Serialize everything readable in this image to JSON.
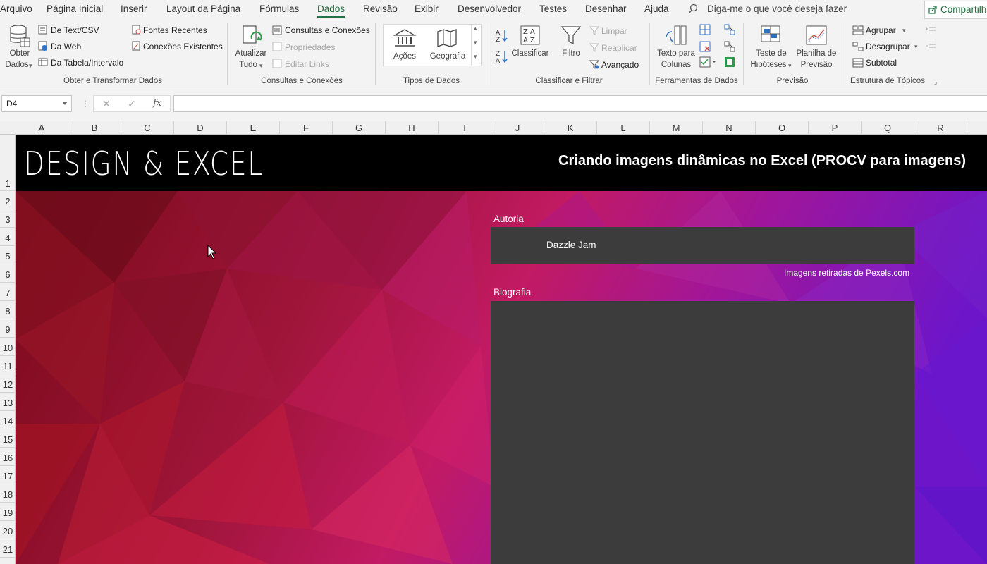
{
  "menu": {
    "tabs": [
      "Arquivo",
      "Página Inicial",
      "Inserir",
      "Layout da Página",
      "Fórmulas",
      "Dados",
      "Revisão",
      "Exibir",
      "Desenvolvedor",
      "Testes",
      "Desenhar",
      "Ajuda"
    ],
    "active_tab": "Dados",
    "tell_me": "Diga-me o que você deseja fazer",
    "share": "Compartilhar"
  },
  "ribbon": {
    "get_transform": {
      "obter_line1": "Obter",
      "obter_line2": "Dados",
      "text_csv": "De Text/CSV",
      "web": "Da Web",
      "table_range": "Da Tabela/Intervalo",
      "recent_sources": "Fontes Recentes",
      "existing_connections": "Conexões Existentes",
      "group_label": "Obter e Transformar Dados"
    },
    "queries": {
      "refresh_line1": "Atualizar",
      "refresh_line2": "Tudo",
      "queries_connections": "Consultas e Conexões",
      "properties": "Propriedades",
      "edit_links": "Editar Links",
      "group_label": "Consultas e Conexões"
    },
    "data_types": {
      "stocks": "Ações",
      "geography": "Geografia",
      "group_label": "Tipos de Dados"
    },
    "sort_filter": {
      "sort": "Classificar",
      "filter": "Filtro",
      "clear": "Limpar",
      "reapply": "Reaplicar",
      "advanced": "Avançado",
      "group_label": "Classificar e Filtrar"
    },
    "data_tools": {
      "text_columns_line1": "Texto para",
      "text_columns_line2": "Colunas",
      "group_label": "Ferramentas de Dados"
    },
    "forecast": {
      "what_if_line1": "Teste de",
      "what_if_line2": "Hipóteses",
      "forecast_sheet_line1": "Planilha de",
      "forecast_sheet_line2": "Previsão",
      "group_label": "Previsão"
    },
    "outline": {
      "group": "Agrupar",
      "ungroup": "Desagrupar",
      "subtotal": "Subtotal",
      "group_label": "Estrutura de Tópicos"
    }
  },
  "formula_bar": {
    "name_box": "D4",
    "fx": "fx",
    "content": ""
  },
  "grid": {
    "columns": [
      "A",
      "B",
      "C",
      "D",
      "E",
      "F",
      "G",
      "H",
      "I",
      "J",
      "K",
      "L",
      "M",
      "N",
      "O",
      "P",
      "Q",
      "R"
    ],
    "rows": [
      "1",
      "2",
      "3",
      "4",
      "5",
      "6",
      "7",
      "8",
      "9",
      "10",
      "11",
      "12",
      "13",
      "14",
      "15",
      "16",
      "17",
      "18",
      "19",
      "20",
      "21"
    ]
  },
  "sheet": {
    "brand": "DESIGN & EXCEL",
    "subtitle": "Criando imagens dinâmicas no Excel (PROCV para imagens)",
    "author_label": "Autoria",
    "author_name": "Dazzle Jam",
    "credit": "Imagens retiradas de Pexels.com",
    "bio_label": "Biografia",
    "bio_text": ""
  },
  "colors": {
    "accent": "#217346",
    "panel": "#3c3c3c",
    "header_band": "#000000"
  }
}
